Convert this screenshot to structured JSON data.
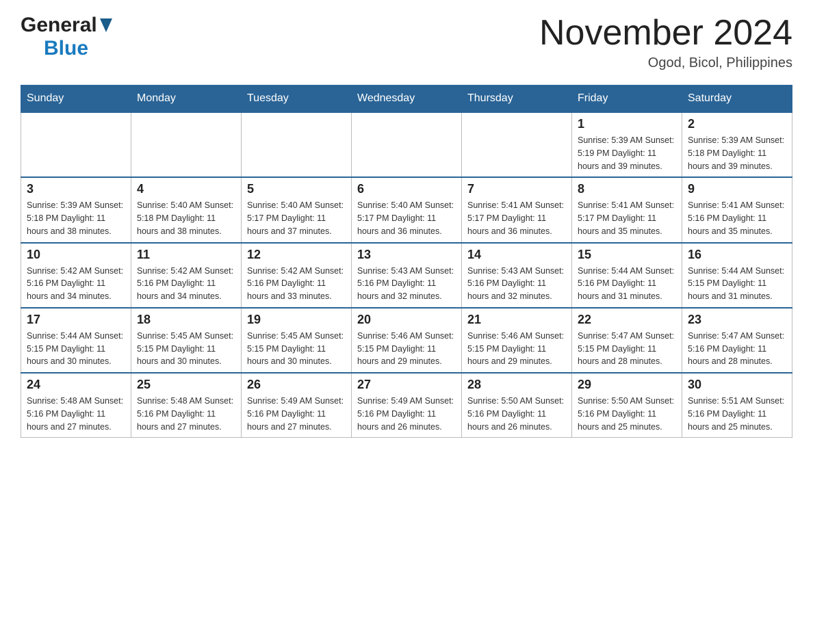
{
  "logo": {
    "general": "General",
    "blue": "Blue"
  },
  "title": "November 2024",
  "subtitle": "Ogod, Bicol, Philippines",
  "weekdays": [
    "Sunday",
    "Monday",
    "Tuesday",
    "Wednesday",
    "Thursday",
    "Friday",
    "Saturday"
  ],
  "weeks": [
    [
      {
        "day": "",
        "info": ""
      },
      {
        "day": "",
        "info": ""
      },
      {
        "day": "",
        "info": ""
      },
      {
        "day": "",
        "info": ""
      },
      {
        "day": "",
        "info": ""
      },
      {
        "day": "1",
        "info": "Sunrise: 5:39 AM\nSunset: 5:19 PM\nDaylight: 11 hours and 39 minutes."
      },
      {
        "day": "2",
        "info": "Sunrise: 5:39 AM\nSunset: 5:18 PM\nDaylight: 11 hours and 39 minutes."
      }
    ],
    [
      {
        "day": "3",
        "info": "Sunrise: 5:39 AM\nSunset: 5:18 PM\nDaylight: 11 hours and 38 minutes."
      },
      {
        "day": "4",
        "info": "Sunrise: 5:40 AM\nSunset: 5:18 PM\nDaylight: 11 hours and 38 minutes."
      },
      {
        "day": "5",
        "info": "Sunrise: 5:40 AM\nSunset: 5:17 PM\nDaylight: 11 hours and 37 minutes."
      },
      {
        "day": "6",
        "info": "Sunrise: 5:40 AM\nSunset: 5:17 PM\nDaylight: 11 hours and 36 minutes."
      },
      {
        "day": "7",
        "info": "Sunrise: 5:41 AM\nSunset: 5:17 PM\nDaylight: 11 hours and 36 minutes."
      },
      {
        "day": "8",
        "info": "Sunrise: 5:41 AM\nSunset: 5:17 PM\nDaylight: 11 hours and 35 minutes."
      },
      {
        "day": "9",
        "info": "Sunrise: 5:41 AM\nSunset: 5:16 PM\nDaylight: 11 hours and 35 minutes."
      }
    ],
    [
      {
        "day": "10",
        "info": "Sunrise: 5:42 AM\nSunset: 5:16 PM\nDaylight: 11 hours and 34 minutes."
      },
      {
        "day": "11",
        "info": "Sunrise: 5:42 AM\nSunset: 5:16 PM\nDaylight: 11 hours and 34 minutes."
      },
      {
        "day": "12",
        "info": "Sunrise: 5:42 AM\nSunset: 5:16 PM\nDaylight: 11 hours and 33 minutes."
      },
      {
        "day": "13",
        "info": "Sunrise: 5:43 AM\nSunset: 5:16 PM\nDaylight: 11 hours and 32 minutes."
      },
      {
        "day": "14",
        "info": "Sunrise: 5:43 AM\nSunset: 5:16 PM\nDaylight: 11 hours and 32 minutes."
      },
      {
        "day": "15",
        "info": "Sunrise: 5:44 AM\nSunset: 5:16 PM\nDaylight: 11 hours and 31 minutes."
      },
      {
        "day": "16",
        "info": "Sunrise: 5:44 AM\nSunset: 5:15 PM\nDaylight: 11 hours and 31 minutes."
      }
    ],
    [
      {
        "day": "17",
        "info": "Sunrise: 5:44 AM\nSunset: 5:15 PM\nDaylight: 11 hours and 30 minutes."
      },
      {
        "day": "18",
        "info": "Sunrise: 5:45 AM\nSunset: 5:15 PM\nDaylight: 11 hours and 30 minutes."
      },
      {
        "day": "19",
        "info": "Sunrise: 5:45 AM\nSunset: 5:15 PM\nDaylight: 11 hours and 30 minutes."
      },
      {
        "day": "20",
        "info": "Sunrise: 5:46 AM\nSunset: 5:15 PM\nDaylight: 11 hours and 29 minutes."
      },
      {
        "day": "21",
        "info": "Sunrise: 5:46 AM\nSunset: 5:15 PM\nDaylight: 11 hours and 29 minutes."
      },
      {
        "day": "22",
        "info": "Sunrise: 5:47 AM\nSunset: 5:15 PM\nDaylight: 11 hours and 28 minutes."
      },
      {
        "day": "23",
        "info": "Sunrise: 5:47 AM\nSunset: 5:16 PM\nDaylight: 11 hours and 28 minutes."
      }
    ],
    [
      {
        "day": "24",
        "info": "Sunrise: 5:48 AM\nSunset: 5:16 PM\nDaylight: 11 hours and 27 minutes."
      },
      {
        "day": "25",
        "info": "Sunrise: 5:48 AM\nSunset: 5:16 PM\nDaylight: 11 hours and 27 minutes."
      },
      {
        "day": "26",
        "info": "Sunrise: 5:49 AM\nSunset: 5:16 PM\nDaylight: 11 hours and 27 minutes."
      },
      {
        "day": "27",
        "info": "Sunrise: 5:49 AM\nSunset: 5:16 PM\nDaylight: 11 hours and 26 minutes."
      },
      {
        "day": "28",
        "info": "Sunrise: 5:50 AM\nSunset: 5:16 PM\nDaylight: 11 hours and 26 minutes."
      },
      {
        "day": "29",
        "info": "Sunrise: 5:50 AM\nSunset: 5:16 PM\nDaylight: 11 hours and 25 minutes."
      },
      {
        "day": "30",
        "info": "Sunrise: 5:51 AM\nSunset: 5:16 PM\nDaylight: 11 hours and 25 minutes."
      }
    ]
  ]
}
